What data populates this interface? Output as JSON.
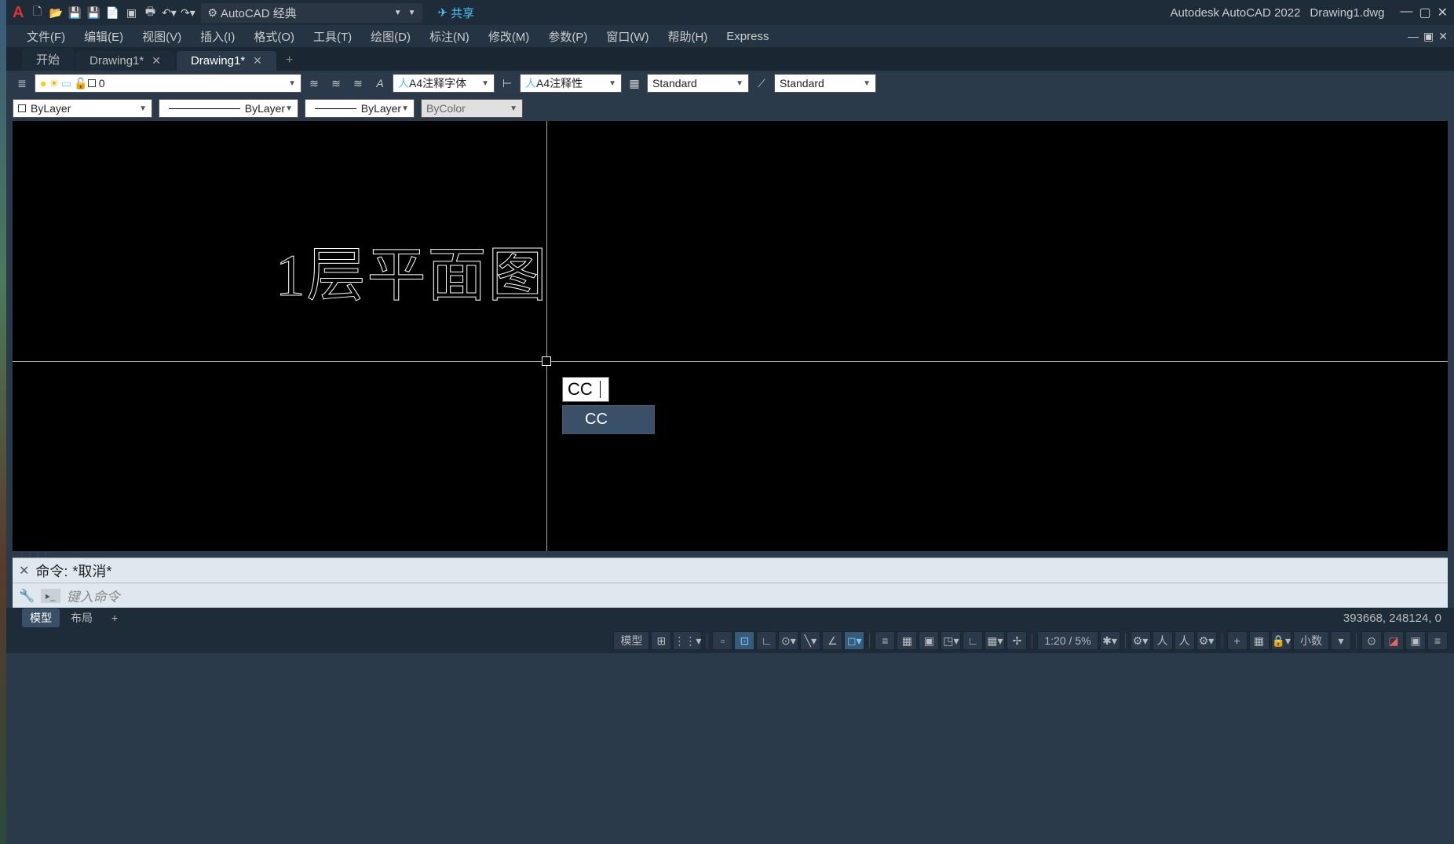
{
  "title": {
    "app": "Autodesk AutoCAD 2022",
    "file": "Drawing1.dwg"
  },
  "workspace": "AutoCAD 经典",
  "share": "共享",
  "menu": [
    "文件(F)",
    "编辑(E)",
    "视图(V)",
    "插入(I)",
    "格式(O)",
    "工具(T)",
    "绘图(D)",
    "标注(N)",
    "修改(M)",
    "参数(P)",
    "窗口(W)",
    "帮助(H)",
    "Express"
  ],
  "tabs": [
    {
      "label": "开始",
      "closable": false,
      "active": false
    },
    {
      "label": "Drawing1*",
      "closable": true,
      "active": false
    },
    {
      "label": "Drawing1*",
      "closable": true,
      "active": true
    }
  ],
  "ribbon": {
    "layer": "0",
    "textStyle": "A4注释字体",
    "dimStyle": "A4注释性",
    "std1": "Standard",
    "std2": "Standard"
  },
  "props": {
    "color": "ByLayer",
    "ltype": "ByLayer",
    "lweight": "ByLayer",
    "plotStyle": "ByColor"
  },
  "canvas": {
    "text": "1层平面图",
    "dynInput": "CC",
    "suggestion": "CC"
  },
  "cmd": {
    "hist_label": "命令:",
    "hist_text": "*取消*",
    "placeholder": "键入命令"
  },
  "layoutTabs": {
    "model": "模型",
    "layout": "布局"
  },
  "coords": "393668, 248124, 0",
  "status": {
    "model": "模型",
    "zoom": "1:20 / 5%",
    "mode": "小数"
  }
}
